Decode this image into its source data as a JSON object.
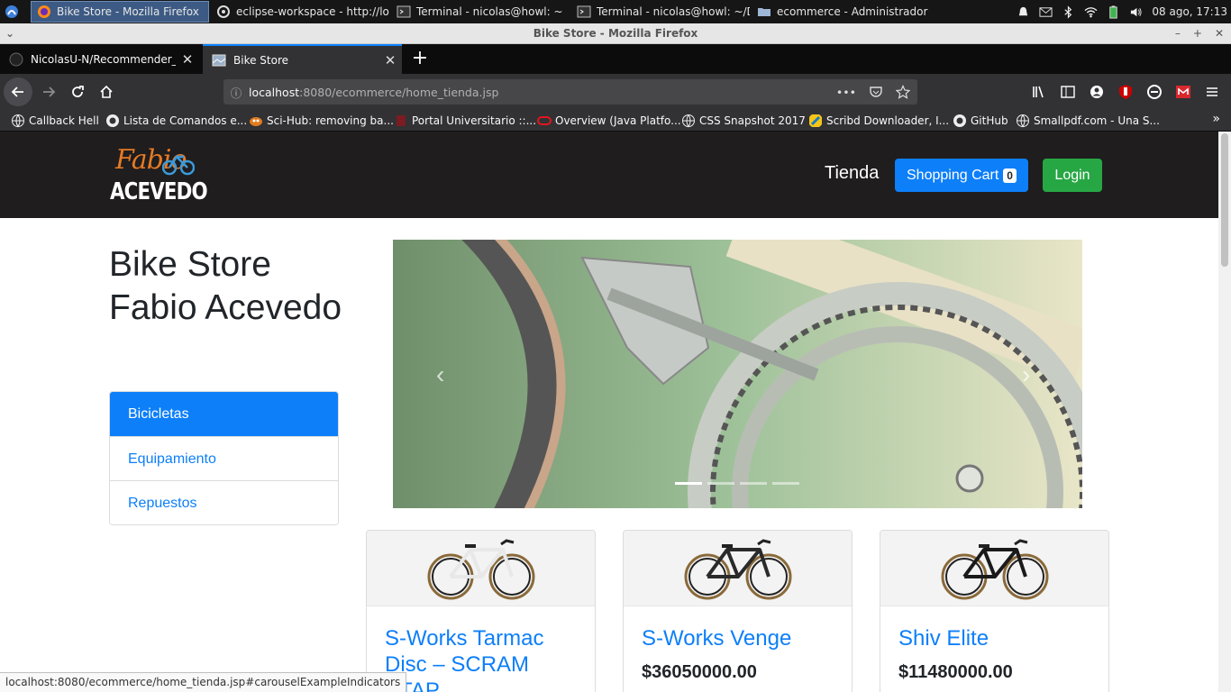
{
  "os": {
    "tasks": [
      {
        "label": "Bike Store - Mozilla Firefox",
        "active": true
      },
      {
        "label": "eclipse-workspace - http://lo...",
        "active": false
      },
      {
        "label": "Terminal - nicolas@howl: ~",
        "active": false
      },
      {
        "label": "Terminal - nicolas@howl: ~/D...",
        "active": false
      },
      {
        "label": "ecommerce - Administrador ...",
        "active": false
      }
    ],
    "clock": "08 ago, 17:13"
  },
  "window": {
    "title": "Bike Store - Mozilla Firefox"
  },
  "tabs": [
    {
      "label": "NicolasU-N/Recommender_sy",
      "selected": false
    },
    {
      "label": "Bike Store",
      "selected": true
    }
  ],
  "url": {
    "host": "localhost",
    "rest": ":8080/ecommerce/home_tienda.jsp"
  },
  "bookmarks": [
    "Callback Hell",
    "Lista de Comandos e...",
    "Sci-Hub: removing ba...",
    "Portal Universitario ::...",
    "Overview (Java Platfo...",
    "CSS Snapshot 2017",
    "Scribd Downloader, I...",
    "GitHub",
    "Smallpdf.com - Una S..."
  ],
  "site": {
    "logo_script": "Fabio",
    "logo_word": "ACEVEDO",
    "nav_tienda": "Tienda",
    "cart_label": "Shopping Cart",
    "cart_count": "0",
    "login_label": "Login",
    "store_title": "Bike Store Fabio Acevedo",
    "categories": [
      "Bicicletas",
      "Equipamiento",
      "Repuestos"
    ],
    "carousel": {
      "prev": "‹",
      "next": "›",
      "slides": 4,
      "active_slide": 1
    }
  },
  "products": [
    {
      "name": "S-Works Tarmac Disc – SCRAM ETAP",
      "price": "",
      "frame_color": "#e8e8e8"
    },
    {
      "name": "S-Works Venge",
      "price": "$36050000.00",
      "frame_color": "#2a2a2a"
    },
    {
      "name": "Shiv Elite",
      "price": "$11480000.00",
      "frame_color": "#1a1a1a"
    }
  ],
  "status_url": "localhost:8080/ecommerce/home_tienda.jsp#carouselExampleIndicators"
}
